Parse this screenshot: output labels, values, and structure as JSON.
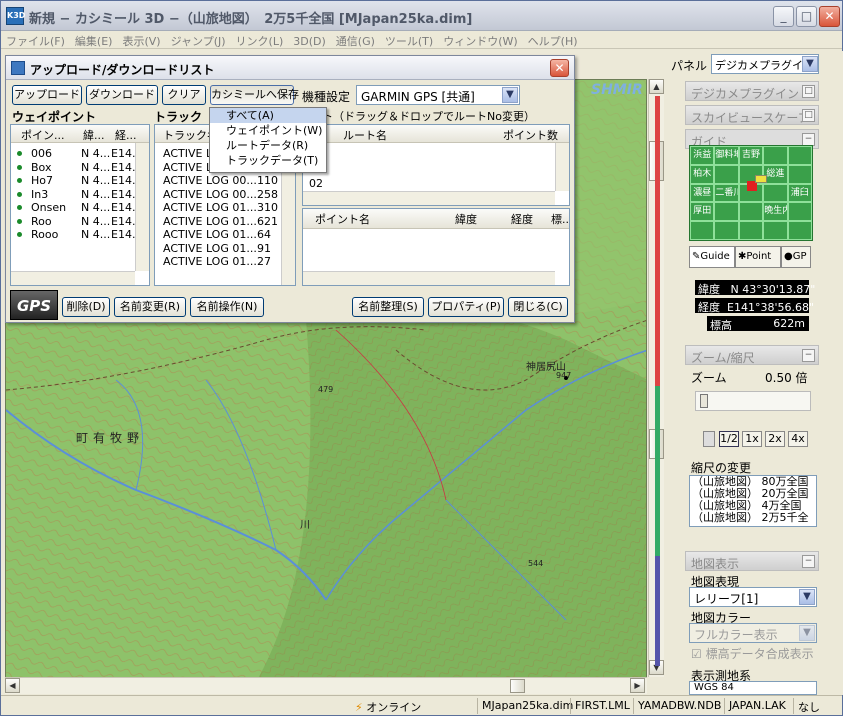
{
  "window": {
    "title": "新規 − カシミール 3D −（山旅地図）　2万5千全国 [MJapan25ka.dim]",
    "minimize": "_",
    "maximize": "□",
    "close": "✕"
  },
  "menu": [
    "ファイル(F)",
    "編集(E)",
    "表示(V)",
    "ジャンプ(J)",
    "リンク(L)",
    "3D(D)",
    "通信(G)",
    "ツール(T)",
    "ウィンドウ(W)",
    "ヘルプ(H)"
  ],
  "map": {
    "labels": {
      "town": "町有牧野",
      "peak": "神居尻山",
      "river": "川",
      "elev1": "479",
      "elev2": "544",
      "elev3": "947"
    },
    "watermark": "SHMIR 3D"
  },
  "panel": {
    "label": "パネル",
    "selector": "デジカメプラグイン",
    "sections": {
      "digicam": "デジカメプラグイン",
      "skyview": "スカイビュースケープ",
      "guide": "ガイド",
      "zoom": "ズーム/縮尺",
      "mapdisp": "地図表示"
    },
    "guide_grid": [
      "浜益",
      "御料地",
      "吉野",
      "",
      "",
      "柏木",
      "",
      "",
      "総進",
      "",
      "濃昼",
      "二番川",
      "",
      "",
      "浦臼",
      "厚田",
      "",
      "",
      "晩生内",
      "",
      "",
      "",
      "",
      "",
      ""
    ],
    "guide_tabs": [
      "Guide",
      "Point",
      "GP"
    ],
    "lat_label": "緯度",
    "lat_value": "N 43°30'13.87\"",
    "lon_label": "経度",
    "lon_value": "E141°38'56.68\"",
    "elev_label": "標高",
    "elev_value": "622m",
    "zoom_label": "ズーム",
    "zoom_value": "0.50 倍",
    "zoom_buttons": [
      "1/2",
      "1x",
      "2x",
      "4x"
    ],
    "scale_change": "縮尺の変更",
    "scale_list": [
      "（山旅地図） 80万全国",
      "（山旅地図） 20万全国",
      "（山旅地図）  4万全国",
      "（山旅地図）  2万5千全"
    ],
    "map_expr_label": "地図表現",
    "map_expr_value": "レリーフ[1]",
    "map_color_label": "地図カラー",
    "map_color_value": "フルカラー表示",
    "elev_merge": "標高データ合成表示",
    "datum_label": "表示測地系",
    "datum_value": "WGS 84"
  },
  "dialog": {
    "title": "アップロード/ダウンロードリスト",
    "close": "✕",
    "buttons": {
      "upload": "アップロード",
      "download": "ダウンロード",
      "clear": "クリア",
      "save": "カシミールへ保存"
    },
    "device_label": "機種設定",
    "device_value": "GARMIN GPS [共通]",
    "waypoint_label": "ウェイポイント",
    "track_label": "トラック",
    "route_label": "ト（ドラッグ＆ドロップでルートNo変更）",
    "wp_headers": [
      "ポイン...",
      "緯...",
      "経..."
    ],
    "waypoints": [
      {
        "name": "006",
        "lat": "N 4...",
        "lon": "E14..."
      },
      {
        "name": "Box",
        "lat": "N 4...",
        "lon": "E14..."
      },
      {
        "name": "Ho7",
        "lat": "N 4...",
        "lon": "E14..."
      },
      {
        "name": "In3",
        "lat": "N 4...",
        "lon": "E14..."
      },
      {
        "name": "Onsen",
        "lat": "N 4...",
        "lon": "E14..."
      },
      {
        "name": "Roo",
        "lat": "N 4...",
        "lon": "E14..."
      },
      {
        "name": "Rooo",
        "lat": "N 4...",
        "lon": "E14..."
      }
    ],
    "track_header": "トラック名",
    "tracks": [
      {
        "name": "ACTIVE L",
        "num": ""
      },
      {
        "name": "ACTIVE L",
        "num": ""
      },
      {
        "name": "ACTIVE LOG 00...",
        "num": "110"
      },
      {
        "name": "ACTIVE LOG 00...",
        "num": "258"
      },
      {
        "name": "ACTIVE LOG 01...",
        "num": "310"
      },
      {
        "name": "ACTIVE LOG 01...",
        "num": "621"
      },
      {
        "name": "ACTIVE LOG 01...",
        "num": "64"
      },
      {
        "name": "ACTIVE LOG 01...",
        "num": "91"
      },
      {
        "name": "ACTIVE LOG 01...",
        "num": "27"
      }
    ],
    "route_headers": [
      "ルート名",
      "ポイント数"
    ],
    "route_rows": [
      "02"
    ],
    "point_headers": [
      "ポイント名",
      "緯度",
      "経度",
      "標..."
    ],
    "bottom_buttons": {
      "delete": "削除(D)",
      "rename": "名前変更(R)",
      "name_op": "名前操作(N)",
      "name_sort": "名前整理(S)",
      "props": "プロパティ(P)",
      "close": "閉じる(C)"
    },
    "popup": [
      "すべて(A)",
      "ウェイポイント(W)",
      "ルートデータ(R)",
      "トラックデータ(T)"
    ]
  },
  "status": {
    "online": "オンライン",
    "map_file": "MJapan25ka.dim",
    "first": "FIRST.LML",
    "yamadb": "YAMADBW.NDB",
    "japan": "JAPAN.LAK",
    "nashi": "なし"
  }
}
